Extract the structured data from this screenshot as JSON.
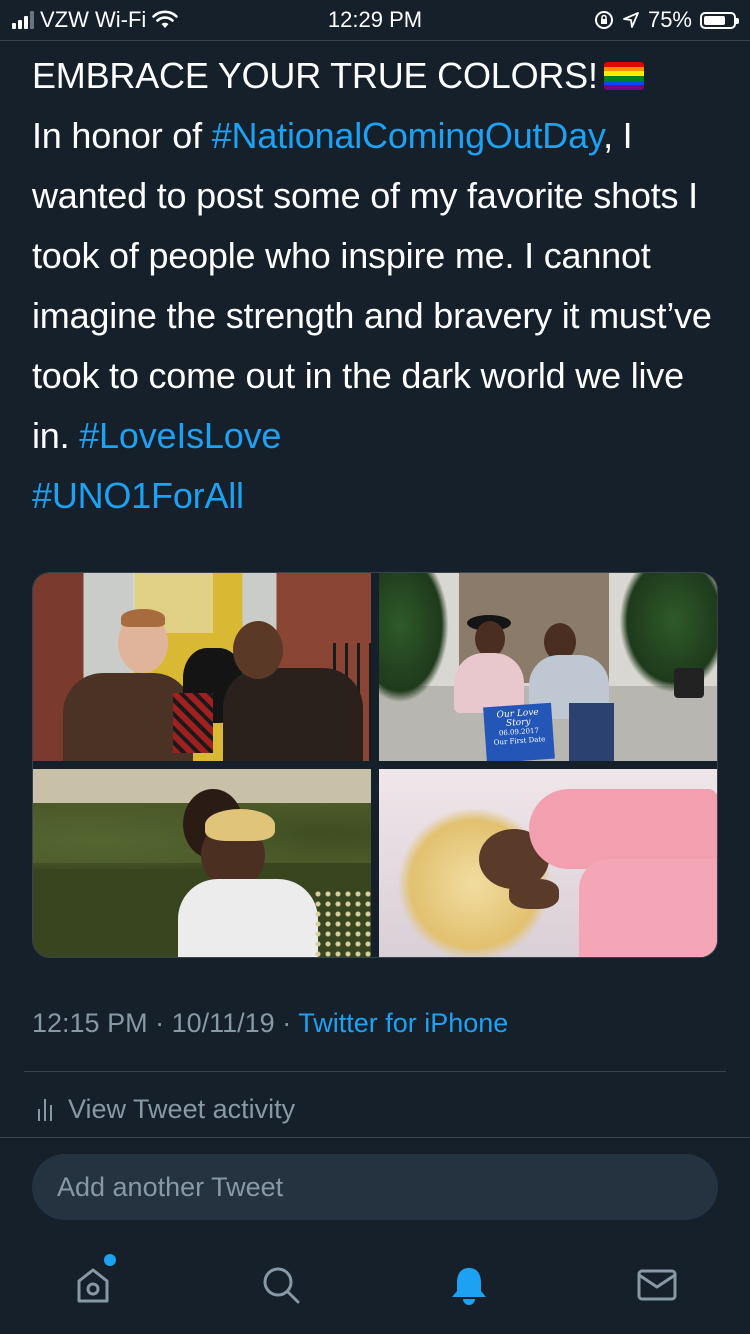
{
  "status_bar": {
    "carrier": "VZW Wi-Fi",
    "time": "12:29 PM",
    "battery": "75%",
    "battery_level": 0.75
  },
  "tweet": {
    "line1": "EMBRACE YOUR TRUE COLORS!",
    "flag_icon": "rainbow-flag-icon",
    "text_a": "In honor of ",
    "hashtag1": "#NationalComingOutDay",
    "text_b": ", I wanted to post some of my favorite shots I took of people who inspire me. I cannot imagine the strength and bravery it must’ve took to come out in the dark world we live in. ",
    "hashtag2": "#LoveIsLove",
    "hashtag3": "#UNO1ForAll",
    "photos": [
      {
        "name": "photo-couple-with-dog"
      },
      {
        "name": "photo-couple-love-story-sign",
        "sign_title": "Our Love Story",
        "sign_line1": "06.09.2017",
        "sign_line2": "Our First Date"
      },
      {
        "name": "photo-piggyback-field"
      },
      {
        "name": "photo-pink-jacket-portrait"
      }
    ]
  },
  "meta": {
    "time": "12:15 PM",
    "separator": " · ",
    "date": "10/11/19",
    "source": "Twitter for iPhone"
  },
  "activity": {
    "label": "View Tweet activity",
    "icon": "activity-chart-icon"
  },
  "reply": {
    "placeholder": "Add another Tweet"
  },
  "tab_bar": {
    "items": [
      {
        "name": "home",
        "icon": "home-icon",
        "badge": true
      },
      {
        "name": "search",
        "icon": "search-icon"
      },
      {
        "name": "notifications",
        "icon": "bell-icon",
        "active": true
      },
      {
        "name": "messages",
        "icon": "mail-icon"
      }
    ]
  },
  "colors": {
    "background": "#15202b",
    "accent": "#1da1f2",
    "secondary_text": "#8899a6",
    "divider": "#38444d"
  }
}
